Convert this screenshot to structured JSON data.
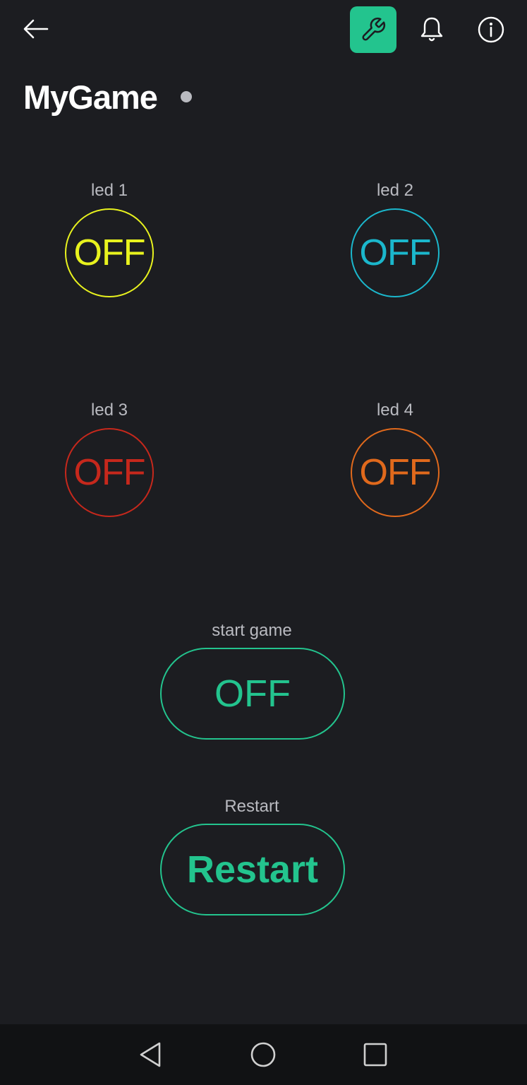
{
  "header": {
    "title": "MyGame",
    "icons": [
      "back-arrow-icon",
      "wrench-icon",
      "bell-icon",
      "info-icon"
    ],
    "accent_color": "#23c48e",
    "status_dot_color": "#b9bac0"
  },
  "leds": [
    {
      "label": "led 1",
      "state": "OFF",
      "color": "#e8f21e"
    },
    {
      "label": "led 2",
      "state": "OFF",
      "color": "#1bb7cc"
    },
    {
      "label": "led 3",
      "state": "OFF",
      "color": "#c6281c"
    },
    {
      "label": "led 4",
      "state": "OFF",
      "color": "#e0691c"
    }
  ],
  "start_game": {
    "label": "start game",
    "button_text": "OFF"
  },
  "restart": {
    "label": "Restart",
    "button_text": "Restart"
  },
  "navbar": {
    "icons": [
      "back-triangle-icon",
      "home-circle-icon",
      "recents-square-icon"
    ]
  }
}
